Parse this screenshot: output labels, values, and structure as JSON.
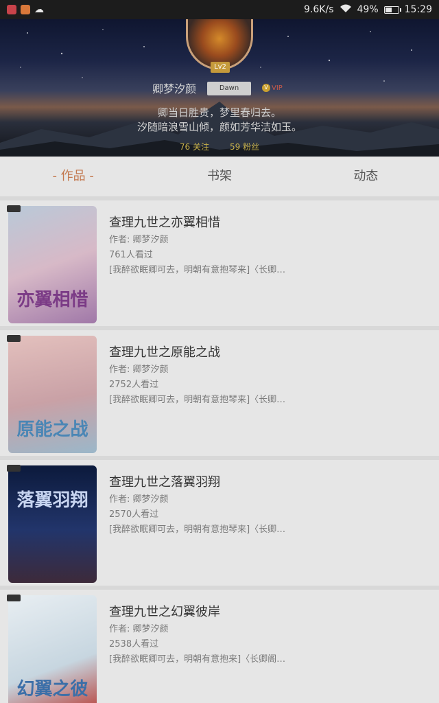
{
  "status_bar": {
    "speed": "9.6K/s",
    "battery": "49%",
    "time": "15:29",
    "icons": [
      "app-icon-red",
      "app-icon-orange",
      "cloud-icon",
      "wifi-icon",
      "battery-icon"
    ]
  },
  "profile": {
    "level": "Lv2",
    "nickname": "卿梦汐颜",
    "tag": "Dawn",
    "vip": "VIP",
    "motto_line1": "卿当日胜贵，梦里春归去。",
    "motto_line2": "汐随暗浪雪山倾，颜如芳华洁如玉。",
    "follow": "76 关注",
    "fans": "59 粉丝"
  },
  "tabs": [
    {
      "label": "- 作品 -",
      "active": true
    },
    {
      "label": "书架",
      "active": false
    },
    {
      "label": "动态",
      "active": false
    }
  ],
  "books": [
    {
      "title": "查理九世之亦翼相惜",
      "author": "作者: 卿梦汐颜",
      "views": "761人看过",
      "desc": "[我醉欲眠卿可去，明朝有意抱琴来]〈长卿…",
      "cover_text": "亦翼相惜",
      "cover_colors": [
        "#b9c9d8",
        "#d7b9c7",
        "#a078a8"
      ]
    },
    {
      "title": "查理九世之原能之战",
      "author": "作者: 卿梦汐颜",
      "views": "2752人看过",
      "desc": "[我醉欲眠卿可去，明朝有意抱琴来]〈长卿…",
      "cover_text": "原能之战",
      "cover_colors": [
        "#e3c0bd",
        "#c9a1a6",
        "#9bb7c9"
      ]
    },
    {
      "title": "查理九世之落翼羽翔",
      "author": "作者: 卿梦汐颜",
      "views": "2570人看过",
      "desc": "[我醉欲眠卿可去，明朝有意抱琴来]〈长卿…",
      "cover_text": "落翼羽翔",
      "cover_colors": [
        "#0c1a3c",
        "#22356b",
        "#3d2a3a"
      ]
    },
    {
      "title": "查理九世之幻翼彼岸",
      "author": "作者: 卿梦汐颜",
      "views": "2538人看过",
      "desc": "[我醉欲眠卿可去，明朝有意抱来]〈长卿阁…",
      "cover_text": "幻翼之彼",
      "cover_colors": [
        "#e8eef2",
        "#c7d6e0",
        "#b8403a"
      ]
    }
  ]
}
